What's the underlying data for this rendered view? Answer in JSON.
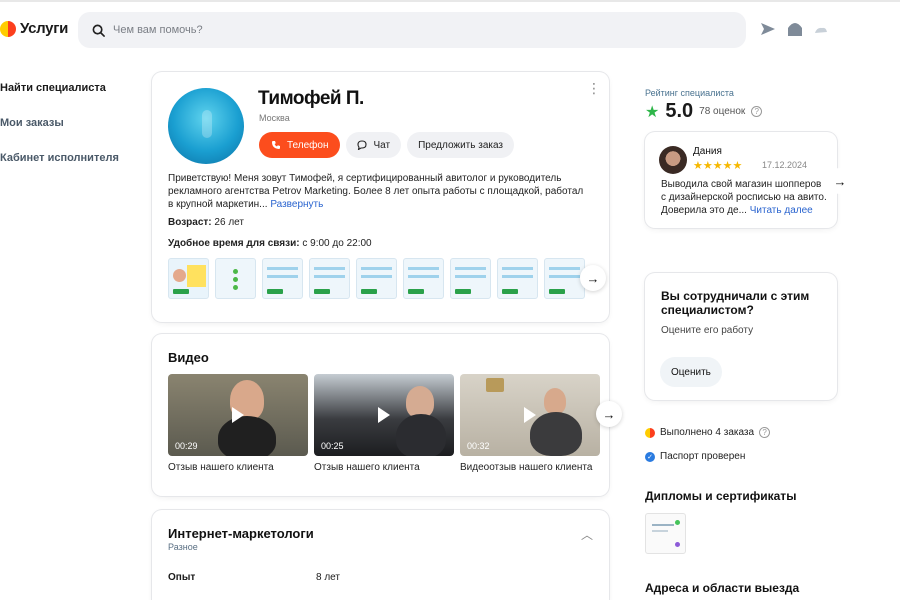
{
  "header": {
    "logo_text": "Услуги",
    "search_placeholder": "Чем вам помочь?"
  },
  "leftnav": {
    "items": [
      {
        "label": "Найти специалиста"
      },
      {
        "label": "Мои заказы"
      },
      {
        "label": "Кабинет исполнителя"
      }
    ]
  },
  "profile": {
    "name": "Тимофей П.",
    "city": "Москва",
    "buttons": {
      "phone": "Телефон",
      "chat": "Чат",
      "offer": "Предложить заказ"
    },
    "about": "Приветствую! Меня зовут Тимофей, я сертифицированный авитолог и руководитель рекламного агентства Petrov Marketing. Более 8 лет опыта работы с площадкой, работал в крупной маркетин...",
    "about_more": "Развернуть",
    "age_label": "Возраст:",
    "age_value": "26 лет",
    "time_label": "Удобное время для связи:",
    "time_value": "с 9:00 до 22:00",
    "portfolio_count": 9
  },
  "video": {
    "title": "Видео",
    "items": [
      {
        "duration": "00:29",
        "caption": "Отзыв нашего клиента"
      },
      {
        "duration": "00:25",
        "caption": "Отзыв нашего клиента"
      },
      {
        "duration": "00:32",
        "caption": "Видеоотзыв нашего клиента"
      }
    ]
  },
  "specialization": {
    "title": "Интернет-маркетологи",
    "subtitle": "Разное",
    "experience_label": "Опыт",
    "experience_value": "8 лет"
  },
  "rating": {
    "label": "Рейтинг специалиста",
    "score": "5.0",
    "reviews_count": "78 оценок"
  },
  "review": {
    "author": "Дания",
    "stars": 5,
    "stars_text": "★★★★★",
    "date": "17.12.2024",
    "text": "Выводила свой магазин шопперов с дизайнерской росписью на авито. Доверила это де...",
    "more": "Читать далее"
  },
  "collab": {
    "title": "Вы сотрудничали с этим специалистом?",
    "subtitle": "Оцените его работу",
    "button": "Оценить"
  },
  "stats": {
    "orders": "Выполнено 4 заказа",
    "passport": "Паспорт проверен"
  },
  "sections": {
    "diplomas": "Дипломы и сертификаты",
    "addresses": "Адреса и области выезда"
  },
  "colors": {
    "accent": "#fc4d1d",
    "link": "#2a64cf",
    "rating_star": "#2fb64a",
    "review_star": "#f6b800"
  }
}
